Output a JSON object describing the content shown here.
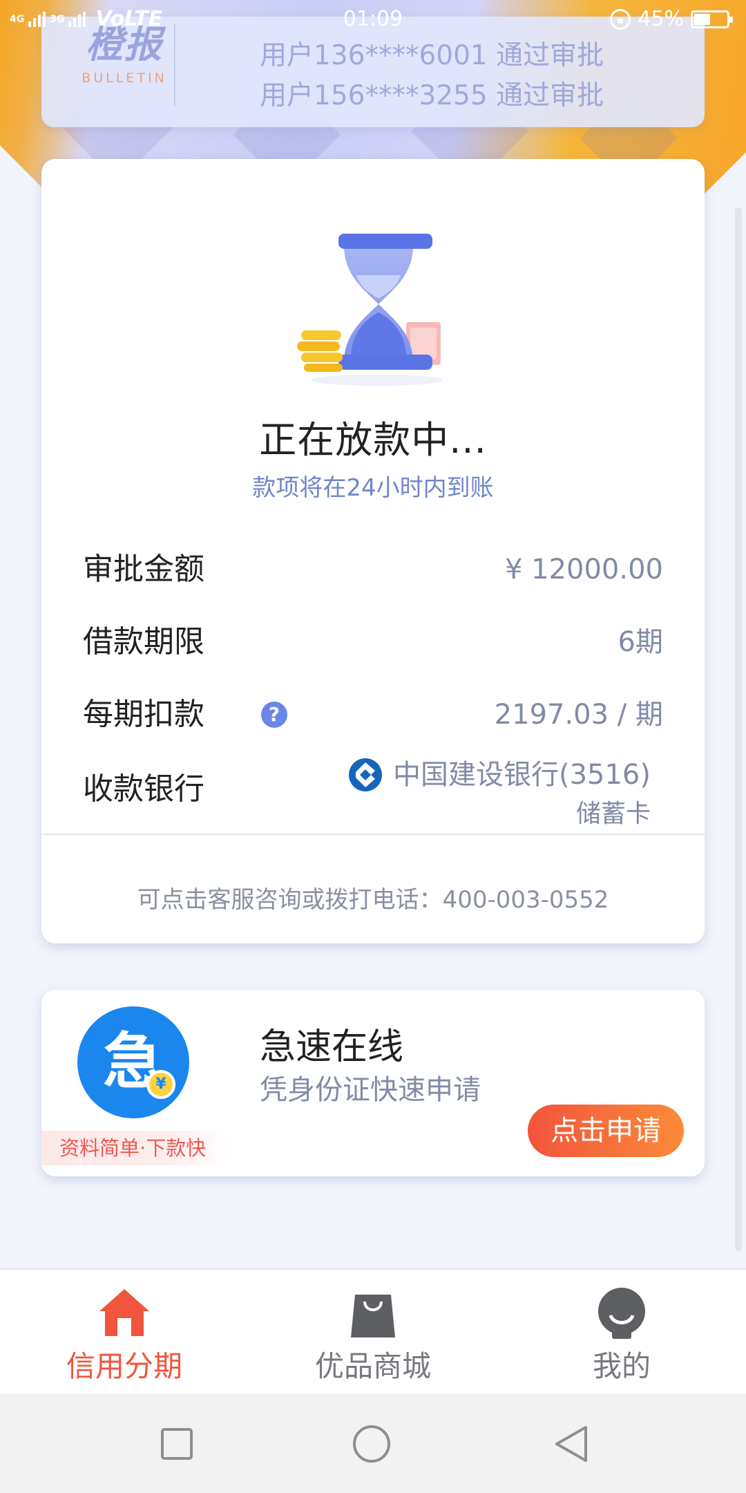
{
  "status_bar": {
    "net_1": "4G",
    "net_2": "3G",
    "volte": "VoLTE",
    "time": "01:09",
    "battery": "45%",
    "battery_level": 0.45
  },
  "bulletin": {
    "logo_main": "橙报",
    "logo_sub": "BULLETIN",
    "messages": [
      "用户136****6001 通过审批",
      "用户156****3255 通过审批"
    ]
  },
  "loan_status": {
    "title": "正在放款中...",
    "subtitle": "款项将在24小时内到账",
    "rows": {
      "amount": {
        "label": "审批金额",
        "value": "¥ 12000.00"
      },
      "term": {
        "label": "借款期限",
        "value": "6期"
      },
      "installment": {
        "label": "每期扣款",
        "value": "2197.03 / 期",
        "help_icon": "question-mark-icon"
      },
      "bank": {
        "label": "收款银行",
        "bank_name": "中国建设银行(3516)",
        "card_type": "储蓄卡",
        "bank_icon": "ccb-logo-icon"
      }
    },
    "hotline": "可点击客服咨询或拨打电话：400-003-0552"
  },
  "promo": {
    "logo_glyph": "急",
    "logo_coin": "¥",
    "tag": "资料简单·下款快",
    "title": "急速在线",
    "subtitle": "凭身份证快速申请",
    "button": "点击申请"
  },
  "tabs": [
    {
      "label": "信用分期",
      "icon": "home-icon",
      "active": true
    },
    {
      "label": "优品商城",
      "icon": "shopping-bag-icon",
      "active": false
    },
    {
      "label": "我的",
      "icon": "profile-icon",
      "active": false
    }
  ],
  "nav": {
    "recent": "square-icon",
    "home": "circle-icon",
    "back": "triangle-back-icon"
  },
  "colors": {
    "accent": "#f1553d",
    "link_blue": "#6f86c9",
    "muted_text": "#828aa6",
    "button_gradient_start": "#f2543c",
    "button_gradient_end": "#fb8b3a",
    "hourglass_blue": "#5a74e6"
  }
}
